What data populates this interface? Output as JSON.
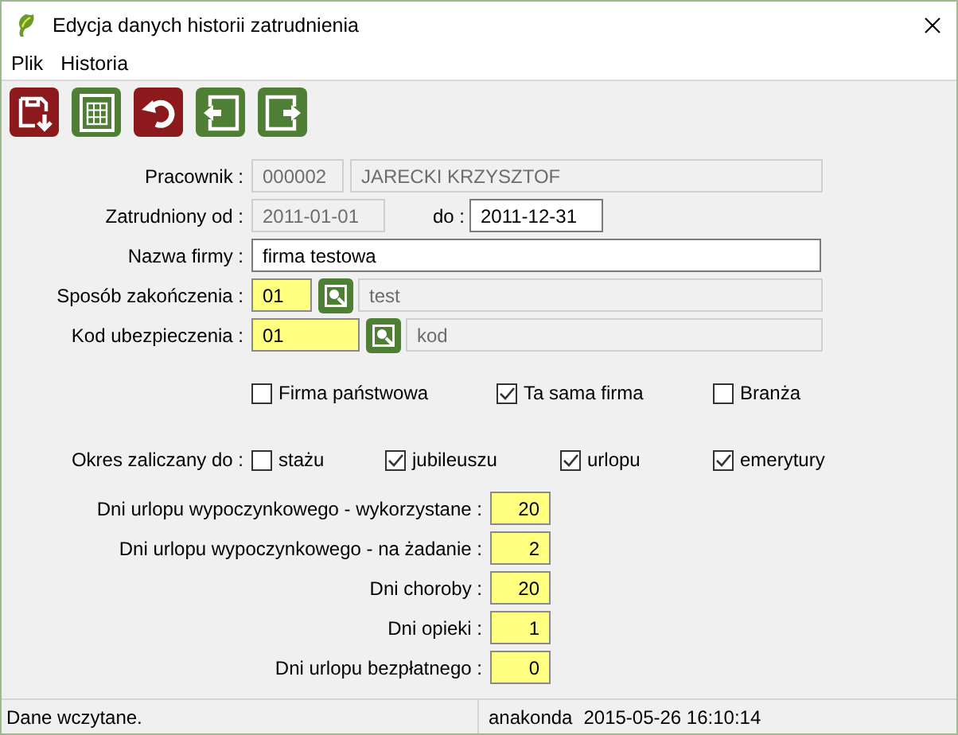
{
  "window": {
    "title": "Edycja danych historii zatrudnienia"
  },
  "menu": [
    "Plik",
    "Historia"
  ],
  "toolbar": [
    {
      "kind": "save"
    },
    {
      "kind": "table"
    },
    {
      "kind": "undo"
    },
    {
      "kind": "prev"
    },
    {
      "kind": "next"
    }
  ],
  "employee": {
    "label": "Pracownik :",
    "id": "000002",
    "name": "JARECKI KRZYSZTOF"
  },
  "employment": {
    "label": "Zatrudniony od :",
    "from": "2011-01-01",
    "to_label": "do :",
    "to": "2011-12-31"
  },
  "company": {
    "label": "Nazwa firmy :",
    "value": "firma testowa"
  },
  "end_reason": {
    "label": "Sposób zakończenia :",
    "code": "01",
    "description": "test"
  },
  "insurance_code": {
    "label": "Kod ubezpieczenia :",
    "code": "01",
    "description": "kod"
  },
  "flags": [
    {
      "label": "Firma państwowa",
      "checked": false
    },
    {
      "label": "Ta sama firma",
      "checked": true
    },
    {
      "label": "Branża",
      "checked": false
    }
  ],
  "period": {
    "label": "Okres zaliczany do :",
    "options": [
      {
        "label": "stażu",
        "checked": false
      },
      {
        "label": "jubileuszu",
        "checked": true
      },
      {
        "label": "urlopu",
        "checked": true
      },
      {
        "label": "emerytury",
        "checked": true
      }
    ]
  },
  "days": [
    {
      "label": "Dni urlopu wypoczynkowego - wykorzystane :",
      "value": "20"
    },
    {
      "label": "Dni urlopu wypoczynkowego - na żadanie :",
      "value": "2"
    },
    {
      "label": "Dni choroby :",
      "value": "20"
    },
    {
      "label": "Dni opieki :",
      "value": "1"
    },
    {
      "label": "Dni urlopu bezpłatnego :",
      "value": "0"
    }
  ],
  "status_bar": {
    "message": "Dane wczytane.",
    "user": "anakonda",
    "timestamp": "2015-05-26 16:10:14"
  }
}
